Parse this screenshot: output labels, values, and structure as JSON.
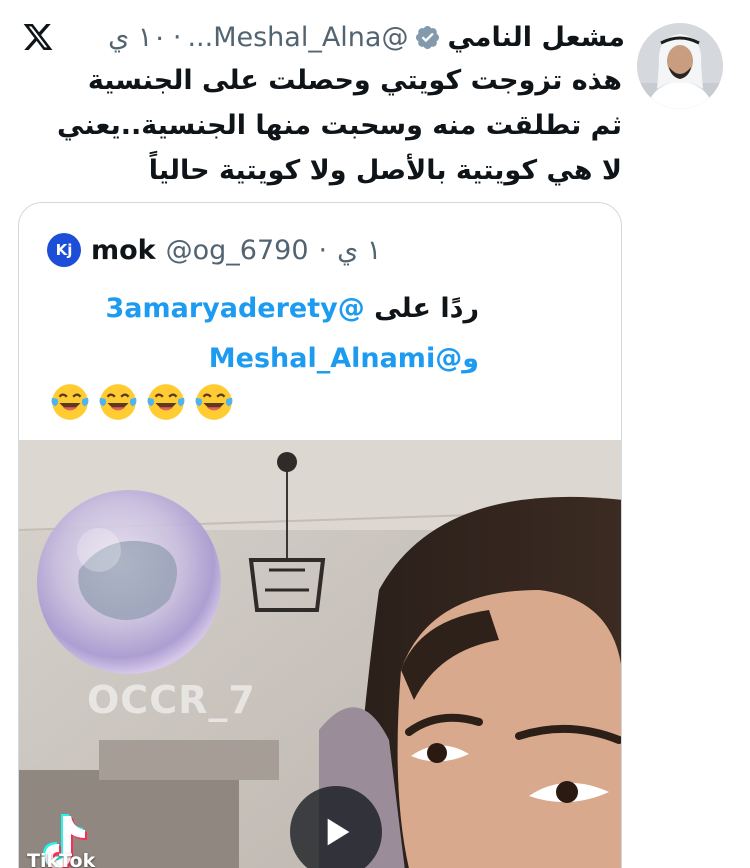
{
  "tweet": {
    "display_name": "مشعل النامي",
    "handle": "@Meshal_Alna...",
    "time": "١٠ ي",
    "separator": "·",
    "lines": [
      "هذه تزوجت كويتي وحصلت على الجنسية",
      "ثم تطلقت منه وسحبت منها الجنسية..يعني",
      "لا هي كويتية بالأصل ولا كويتية حالياً"
    ]
  },
  "quote": {
    "avatar_initials": "Kj",
    "name": "mok",
    "handle": "@og_6790",
    "separator": "·",
    "time": "١ ي",
    "reply_prefix": "ردًا على",
    "mention_1": "@3amaryaderety",
    "mention_2_prefix": "و",
    "mention_2": "@Meshal_Alnami",
    "emojis": [
      "😂",
      "😂",
      "😂",
      "😂"
    ],
    "media": {
      "watermark": "OCCR_7",
      "tiktok_label": "TikTok"
    }
  },
  "icons": {
    "platform": "x-logo-icon",
    "verified": "verified-badge-icon",
    "play": "play-icon"
  },
  "colors": {
    "accent": "#1d9bf0",
    "text": "#0f1419",
    "secondary": "#536471",
    "border": "#cfd9de"
  }
}
